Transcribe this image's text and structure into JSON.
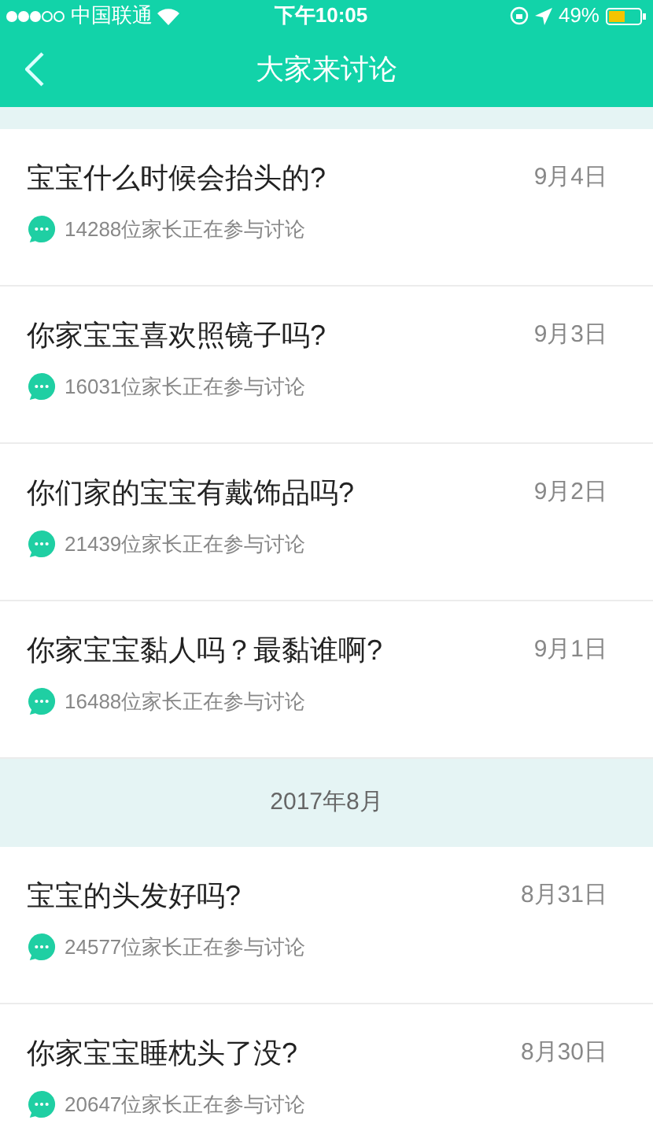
{
  "status_bar": {
    "carrier": "中国联通",
    "time": "下午10:05",
    "battery": "49%"
  },
  "nav": {
    "title": "大家来讨论"
  },
  "sections": [
    {
      "topics": [
        {
          "title": "宝宝什么时候会抬头的?",
          "date": "9月4日",
          "participants": "14288位家长正在参与讨论"
        },
        {
          "title": "你家宝宝喜欢照镜子吗?",
          "date": "9月3日",
          "participants": "16031位家长正在参与讨论"
        },
        {
          "title": "你们家的宝宝有戴饰品吗?",
          "date": "9月2日",
          "participants": "21439位家长正在参与讨论"
        },
        {
          "title": "你家宝宝黏人吗？最黏谁啊?",
          "date": "9月1日",
          "participants": "16488位家长正在参与讨论"
        }
      ]
    },
    {
      "header": "2017年8月",
      "topics": [
        {
          "title": "宝宝的头发好吗?",
          "date": "8月31日",
          "participants": "24577位家长正在参与讨论"
        },
        {
          "title": "你家宝宝睡枕头了没?",
          "date": "8月30日",
          "participants": "20647位家长正在参与讨论"
        }
      ]
    }
  ]
}
